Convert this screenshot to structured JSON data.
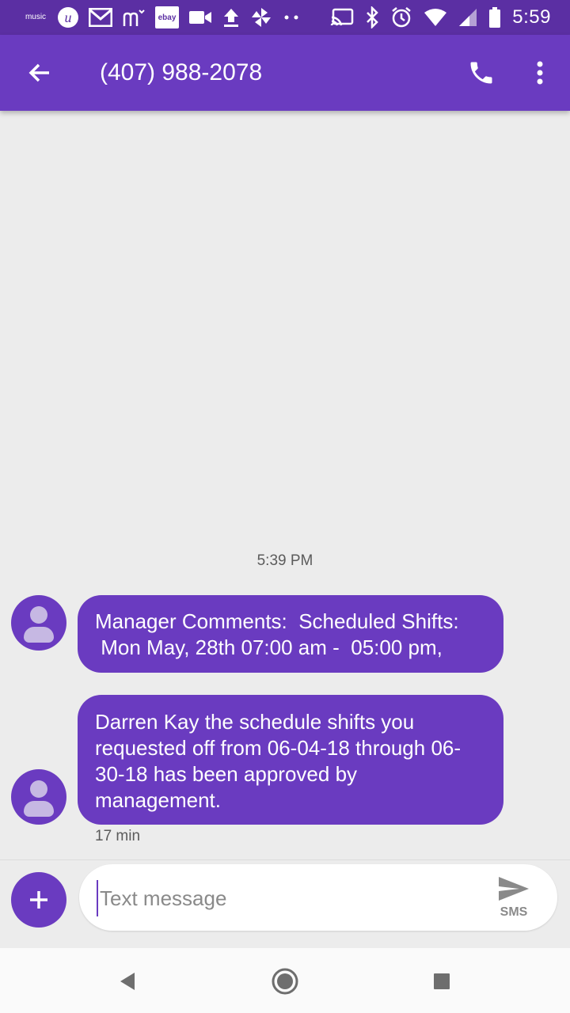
{
  "status_bar": {
    "music_label": "music",
    "ebay_label": "ebay",
    "time": "5:59",
    "icons": [
      "amazon-music-icon",
      "app-u-icon",
      "gmail-icon",
      "m-icon",
      "ebay-icon",
      "video-icon",
      "upload-icon",
      "pinwheel-icon",
      "more-dots-icon",
      "cast-icon",
      "bluetooth-icon",
      "alarm-icon",
      "wifi-icon",
      "signal-icon",
      "battery-icon"
    ]
  },
  "app_bar": {
    "title": "(407) 988-2078",
    "icons": [
      "back-arrow-icon",
      "phone-icon",
      "more-vert-icon"
    ]
  },
  "conversation": {
    "timestamp": "5:39 PM",
    "messages": [
      {
        "text": "Manager Comments:  Scheduled Shifts:\n Mon May, 28th 07:00 am -  05:00 pm,"
      },
      {
        "text": "Darren Kay the schedule shifts you requested off from 06-04-18 through 06-30-18 has been approved by management."
      }
    ],
    "message_meta": "17 min"
  },
  "composer": {
    "placeholder": "Text message",
    "value": "",
    "send_label": "SMS"
  },
  "nav_bar": {
    "icons": [
      "back-triangle-icon",
      "home-circle-icon",
      "recents-square-icon"
    ]
  },
  "colors": {
    "accent": "#6a3bc0",
    "status_bar": "#5b2fa3",
    "background": "#ececec"
  }
}
